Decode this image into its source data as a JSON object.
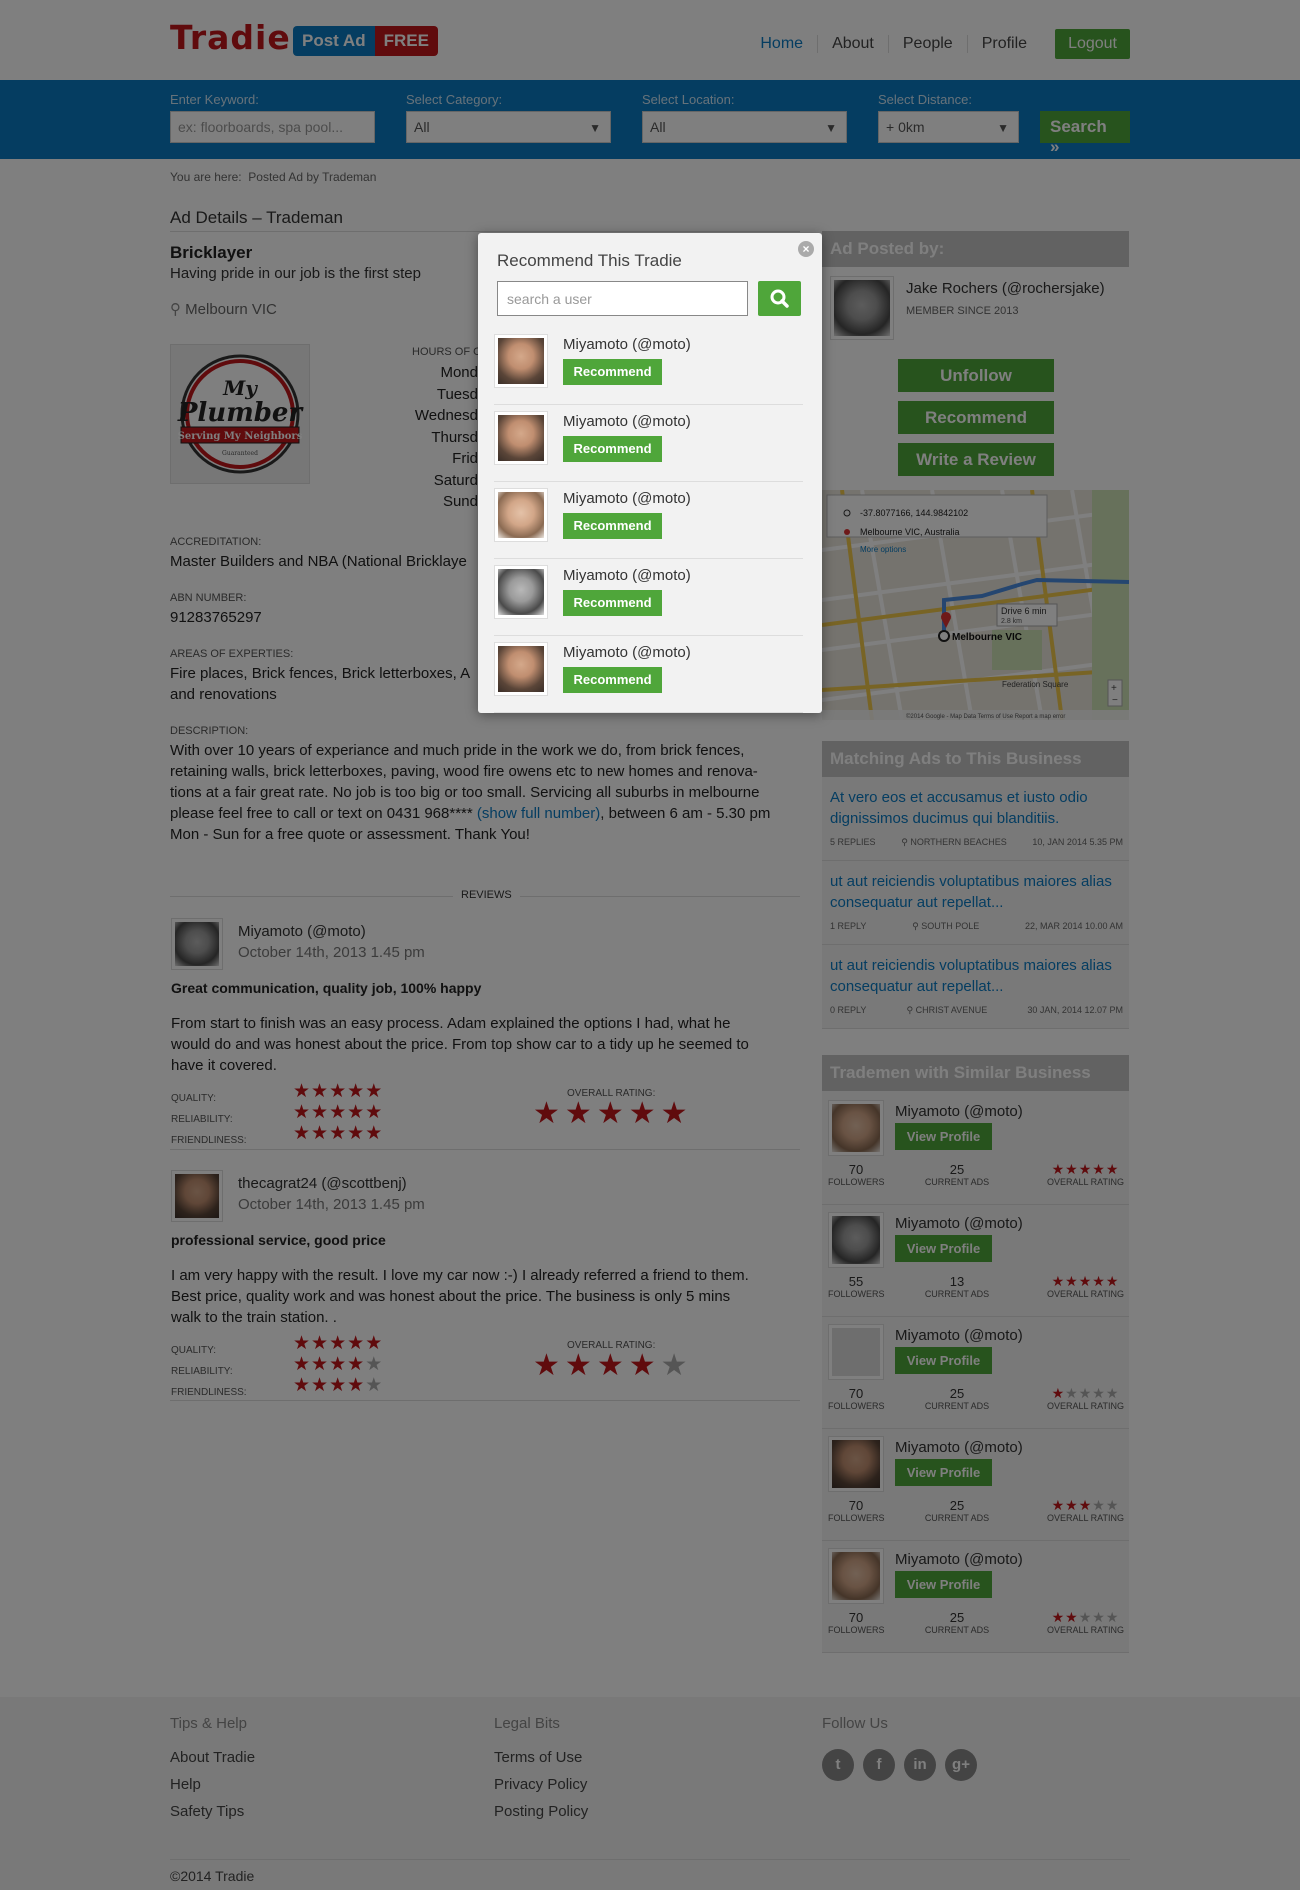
{
  "header": {
    "logo": "Tradie",
    "post_ad": "Post Ad",
    "post_ad_free": "FREE",
    "nav": [
      "Home",
      "About",
      "People",
      "Profile"
    ],
    "logout": "Logout"
  },
  "search": {
    "keyword_label": "Enter Keyword:",
    "keyword_placeholder": "ex: floorboards, spa pool...",
    "category_label": "Select Category:",
    "category_value": "All",
    "location_label": "Select Location:",
    "location_value": "All",
    "distance_label": "Select Distance:",
    "distance_value": "+ 0km",
    "button": "Search"
  },
  "breadcrumb": {
    "prefix": "You are here:",
    "current": "Posted Ad by Trademan"
  },
  "ad": {
    "section_title": "Ad Details – Trademan",
    "trade": "Bricklayer",
    "tagline": "Having pride in our job is the first step",
    "location": "Melbourn VIC",
    "hours_label": "HOURS OF O",
    "days": [
      "Mond",
      "Tuesd",
      "Wednesd",
      "Thursd",
      "Frid",
      "Saturd",
      "Sund"
    ],
    "logo_text_top": "My",
    "logo_text_main": "Plumber",
    "logo_text_sub": "Serving My Neighbors",
    "logo_text_small": "Guaranteed",
    "accreditation_label": "ACCREDITATION:",
    "accreditation": "Master Builders and NBA (National Bricklaye",
    "abn_label": "ABN NUMBER:",
    "abn": "91283765297",
    "areas_label": "AREAS OF EXPERTIES:",
    "areas_line1": "Fire places, Brick fences, Brick letterboxes, A",
    "areas_line2": "and renovations",
    "description_label": "DESCRIPTION:",
    "description_line1": "With over 10 years of experiance and much pride in the work we do, from brick fences,",
    "description_line2": "retaining walls, brick letterboxes, paving, wood fire owens etc to new homes and renova-",
    "description_line3": "tions at a fair great rate. No job is too big or too small. Servicing all suburbs in melbourne",
    "description_line4a": "please feel free to call or text on 0431 968****",
    "description_link": "(show full number)",
    "description_line4b": ", between 6 am - 5.30 pm",
    "description_line5": "Mon - Sun for a free quote or assessment. Thank You!"
  },
  "reviews": {
    "title": "REVIEWS",
    "items": [
      {
        "author": "Miyamoto (@moto)",
        "date": "October 14th, 2013 1.45 pm",
        "headline": "Great communication, quality job, 100% happy",
        "body_line1": "From start to finish was an easy process. Adam explained the options I had, what he",
        "body_line2": "would do and was honest about the price. From top show car to a tidy up he seemed to",
        "body_line3": "have it covered.",
        "quality_label": "QUALITY:",
        "quality": 5,
        "reliability_label": "RELIABILITY:",
        "reliability": 5,
        "friendliness_label": "FRIENDLINESS:",
        "friendliness": 5,
        "overall_label": "OVERALL RATING:",
        "overall": 5
      },
      {
        "author": "thecagrat24  (@scottbenj)",
        "date": "October 14th, 2013 1.45 pm",
        "headline": "professional service, good price",
        "body_line1": "I am very happy with the result. I love my car now :-) I already referred a friend to them.",
        "body_line2": "Best price, quality work and was honest about the price. The business is only 5 mins",
        "body_line3": "walk to the train station.  .",
        "quality_label": "QUALITY:",
        "quality": 5,
        "reliability_label": "RELIABILITY:",
        "reliability": 4,
        "friendliness_label": "FRIENDLINESS:",
        "friendliness": 4,
        "overall_label": "OVERALL RATING:",
        "overall": 4
      }
    ]
  },
  "poster": {
    "heading": "Ad Posted by:",
    "name": "Jake Rochers  (@rochersjake)",
    "member_since": "MEMBER SINCE 2013",
    "unfollow": "Unfollow",
    "recommend": "Recommend",
    "review": "Write a Review"
  },
  "map": {
    "coords": "-37.8077166, 144.9842102",
    "address": "Melbourne VIC, Australia",
    "more": "More options",
    "drive": "Drive 6 min",
    "drive_km": "2.8 km",
    "pin_label": "Melbourne VIC",
    "area_label": "Federation Square",
    "footer": "©2014 Google - Map Data    Terms of Use    Report a map error"
  },
  "matching": {
    "heading": "Matching Ads to This Business",
    "items": [
      {
        "title": "At vero eos et accusamus et iusto odio dignissimos ducimus qui blanditiis.",
        "replies": "5 REPLIES",
        "place": "NORTHERN BEACHES",
        "date": "10, JAN 2014 5.35 PM"
      },
      {
        "title": "ut aut reiciendis voluptatibus maiores alias consequatur aut repellat...",
        "replies": "1 REPLY",
        "place": "SOUTH POLE",
        "date": "22, MAR 2014 10.00 AM"
      },
      {
        "title": "ut aut reiciendis voluptatibus maiores alias consequatur aut repellat...",
        "replies": "0 REPLY",
        "place": "CHRIST AVENUE",
        "date": "30 JAN, 2014 12.07 PM"
      }
    ]
  },
  "similar": {
    "heading": "Trademen with Similar Business",
    "view_label": "View Profile",
    "followers_label": "FOLLOWERS",
    "ads_label": "CURRENT ADS",
    "rating_label": "OVERALL RATING",
    "items": [
      {
        "name": "Miyamoto (@moto)",
        "followers": "70",
        "ads": "25",
        "rating": 5
      },
      {
        "name": "Miyamoto (@moto)",
        "followers": "55",
        "ads": "13",
        "rating": 5
      },
      {
        "name": "Miyamoto (@moto)",
        "followers": "70",
        "ads": "25",
        "rating": 1
      },
      {
        "name": "Miyamoto (@moto)",
        "followers": "70",
        "ads": "25",
        "rating": 3
      },
      {
        "name": "Miyamoto (@moto)",
        "followers": "70",
        "ads": "25",
        "rating": 2
      }
    ]
  },
  "footer": {
    "tips_heading": "Tips & Help",
    "tips": [
      "About Tradie",
      "Help",
      "Safety Tips"
    ],
    "legal_heading": "Legal Bits",
    "legal": [
      "Terms of Use",
      "Privacy Policy",
      "Posting Policy"
    ],
    "follow_heading": "Follow Us",
    "social": [
      "twitter-icon",
      "facebook-icon",
      "linkedin-icon",
      "googleplus-icon"
    ],
    "copyright": "©2014 Tradie"
  },
  "modal": {
    "title": "Recommend This Tradie",
    "search_placeholder": "search a user",
    "button_label": "Recommend",
    "users": [
      "Miyamoto (@moto)",
      "Miyamoto (@moto)",
      "Miyamoto (@moto)",
      "Miyamoto (@moto)",
      "Miyamoto (@moto)"
    ]
  },
  "colors": {
    "brand_red": "#c0161b",
    "brand_blue": "#0b7bc3",
    "green": "#4fa63a"
  }
}
